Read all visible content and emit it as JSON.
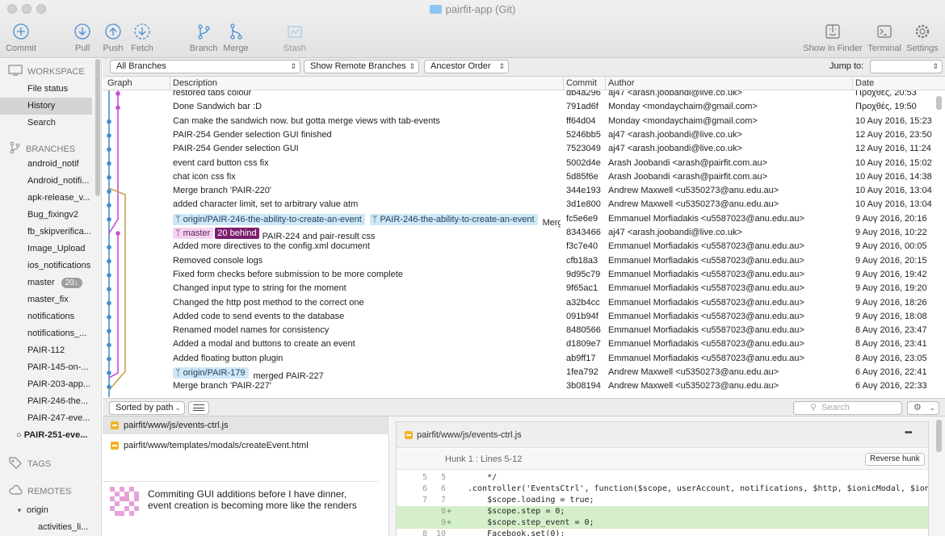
{
  "window": {
    "title": "pairfit-app (Git)"
  },
  "toolbar": {
    "commit": "Commit",
    "pull": "Pull",
    "push": "Push",
    "fetch": "Fetch",
    "branch": "Branch",
    "merge": "Merge",
    "stash": "Stash",
    "show_in_finder": "Show in Finder",
    "terminal": "Terminal",
    "settings": "Settings"
  },
  "sidebar": {
    "workspace": "WORKSPACE",
    "workspace_items": [
      "File status",
      "History",
      "Search"
    ],
    "branches": "BRANCHES",
    "branch_items": [
      "android_notif",
      "Android_notifi...",
      "apk-release_v...",
      "Bug_fixingv2",
      "fb_skipverifica...",
      "Image_Upload",
      "ios_notifications",
      "master",
      "master_fix",
      "notifications",
      "notifications_...",
      "PAIR-112",
      "PAIR-145-on-...",
      "PAIR-203-app...",
      "PAIR-246-the...",
      "PAIR-247-eve...",
      "PAIR-251-eve..."
    ],
    "master_badge": "20↓",
    "tags": "TAGS",
    "remotes": "REMOTES",
    "remote_origin": "origin",
    "remote_item": "activities_li..."
  },
  "filters": {
    "branches": "All Branches",
    "remote": "Show Remote Branches",
    "order": "Ancestor Order",
    "jump_to": "Jump to:"
  },
  "table": {
    "headers": {
      "graph": "Graph",
      "description": "Description",
      "commit": "Commit",
      "author": "Author",
      "date": "Date"
    },
    "rows": [
      {
        "desc": "restored tabs colour",
        "hash": "db4a296",
        "author": "aj47 <arash.joobandi@live.co.uk>",
        "date": "Προχθές, 20:53"
      },
      {
        "desc": "Done Sandwich bar :D",
        "hash": "791ad6f",
        "author": "Monday <mondaychaim@gmail.com>",
        "date": "Προχθές, 19:50"
      },
      {
        "desc": "Can make the sandwich now. but gotta merge views with tab-events",
        "hash": "ff64d04",
        "author": "Monday <mondaychaim@gmail.com>",
        "date": "10 Αυγ 2016, 15:23"
      },
      {
        "desc": "PAIR-254 Gender selection GUI finished",
        "hash": "5246bb5",
        "author": "aj47 <arash.joobandi@live.co.uk>",
        "date": "12 Αυγ 2016, 23:50"
      },
      {
        "desc": "PAIR-254 Gender selection GUI",
        "hash": "7523049",
        "author": "aj47 <arash.joobandi@live.co.uk>",
        "date": "12 Αυγ 2016, 11:24"
      },
      {
        "desc": "event card button css fix",
        "hash": "5002d4e",
        "author": "Arash Joobandi <arash@pairfit.com.au>",
        "date": "10 Αυγ 2016, 15:02"
      },
      {
        "desc": "chat icon css fix",
        "hash": "5d85f6e",
        "author": "Arash Joobandi <arash@pairfit.com.au>",
        "date": "10 Αυγ 2016, 14:38"
      },
      {
        "desc": "Merge branch 'PAIR-220'",
        "hash": "344e193",
        "author": "Andrew Maxwell <u5350273@anu.edu.au>",
        "date": "10 Αυγ 2016, 13:04"
      },
      {
        "desc": "added character limit, set to arbitrary value atm",
        "hash": "3d1e800",
        "author": "Andrew Maxwell <u5350273@anu.edu.au>",
        "date": "10 Αυγ 2016, 13:04"
      },
      {
        "desc": "Merge bra...",
        "hash": "fc5e6e9",
        "author": "Emmanuel Morfiadakis <u5587023@anu.edu.au>",
        "date": "9 Αυγ 2016, 20:16"
      },
      {
        "desc": "PAIR-224 and pair-result css",
        "hash": "8343466",
        "author": "aj47 <arash.joobandi@live.co.uk>",
        "date": "9 Αυγ 2016, 10:22"
      },
      {
        "desc": "Added more directives to the config.xml document",
        "hash": "f3c7e40",
        "author": "Emmanuel Morfiadakis <u5587023@anu.edu.au>",
        "date": "9 Αυγ 2016, 00:05"
      },
      {
        "desc": "Removed console logs",
        "hash": "cfb18a3",
        "author": "Emmanuel Morfiadakis <u5587023@anu.edu.au>",
        "date": "9 Αυγ 2016, 20:15"
      },
      {
        "desc": "Fixed form checks before submission to be more complete",
        "hash": "9d95c79",
        "author": "Emmanuel Morfiadakis <u5587023@anu.edu.au>",
        "date": "9 Αυγ 2016, 19:42"
      },
      {
        "desc": "Changed input type to string for the moment",
        "hash": "9f65ac1",
        "author": "Emmanuel Morfiadakis <u5587023@anu.edu.au>",
        "date": "9 Αυγ 2016, 19:20"
      },
      {
        "desc": "Changed the http post method to the correct one",
        "hash": "a32b4cc",
        "author": "Emmanuel Morfiadakis <u5587023@anu.edu.au>",
        "date": "9 Αυγ 2016, 18:26"
      },
      {
        "desc": "Added code to send events to the database",
        "hash": "091b94f",
        "author": "Emmanuel Morfiadakis <u5587023@anu.edu.au>",
        "date": "9 Αυγ 2016, 18:08"
      },
      {
        "desc": "Renamed model names for consistency",
        "hash": "8480566",
        "author": "Emmanuel Morfiadakis <u5587023@anu.edu.au>",
        "date": "8 Αυγ 2016, 23:47"
      },
      {
        "desc": "Added a modal and buttons to create an event",
        "hash": "d1809e7",
        "author": "Emmanuel Morfiadakis <u5587023@anu.edu.au>",
        "date": "8 Αυγ 2016, 23:41"
      },
      {
        "desc": "Added floating button plugin",
        "hash": "ab9ff17",
        "author": "Emmanuel Morfiadakis <u5587023@anu.edu.au>",
        "date": "8 Αυγ 2016, 23:05"
      },
      {
        "desc": "merged PAIR-227",
        "hash": "1fea792",
        "author": "Andrew Maxwell <u5350273@anu.edu.au>",
        "date": "6 Αυγ 2016, 22:41"
      },
      {
        "desc": "Merge branch 'PAIR-227'",
        "hash": "3b08194",
        "author": "Andrew Maxwell <u5350273@anu.edu.au>",
        "date": "6 Αυγ 2016, 22:33"
      }
    ],
    "refs": {
      "origin_246": "origin/PAIR-246-the-ability-to-create-an-event",
      "local_246": "PAIR-246-the-ability-to-create-an-event",
      "master": "master",
      "behind": "20 behind",
      "origin_179": "origin/PAIR-179"
    }
  },
  "bottom": {
    "sort": "Sorted by path",
    "search_placeholder": "Search",
    "files": [
      "pairfit/www/js/events-ctrl.js",
      "pairfit/www/templates/modals/createEvent.html"
    ],
    "commit_message": "Commiting GUI additions before I have dinner, event creation is becoming more like the renders",
    "diff_file": "pairfit/www/js/events-ctrl.js",
    "hunk_title": "Hunk 1 : Lines 5-12",
    "reverse_hunk": "Reverse hunk",
    "more": "•••",
    "diff_lines": [
      {
        "n1": "5",
        "n2": "5",
        "pm": "",
        "code": "    */",
        "type": "ctx"
      },
      {
        "n1": "6",
        "n2": "6",
        "pm": "",
        "code": ".controller('EventsCtrl', function($scope, userAccount, notifications, $http, $ionicModal, $ionicPopup,",
        "type": "ctx"
      },
      {
        "n1": "7",
        "n2": "7",
        "pm": "",
        "code": "    $scope.loading = true;",
        "type": "ctx"
      },
      {
        "n1": "",
        "n2": "8",
        "pm": "+",
        "code": "    $scope.step = 0;",
        "type": "add"
      },
      {
        "n1": "",
        "n2": "9",
        "pm": "+",
        "code": "    $scope.step_event = 0;",
        "type": "add"
      },
      {
        "n1": "8",
        "n2": "10",
        "pm": "",
        "code": "    Facebook.set(0);",
        "type": "ctx"
      }
    ]
  }
}
